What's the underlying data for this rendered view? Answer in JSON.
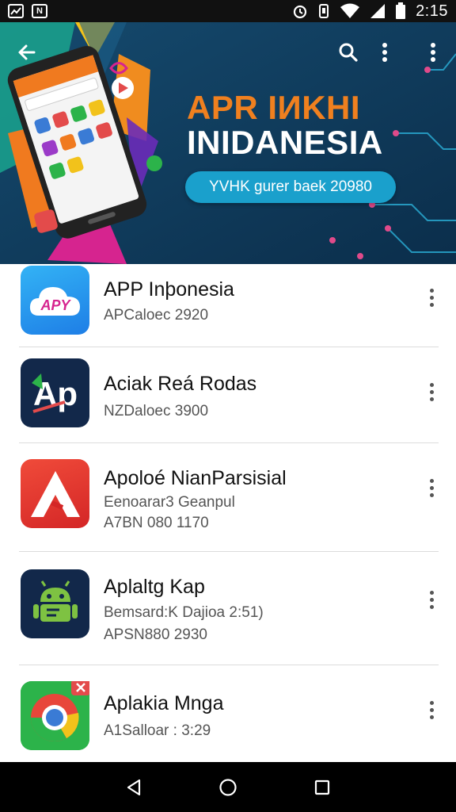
{
  "status_bar": {
    "time": "2:15",
    "icons": [
      "notification-icon",
      "news-icon",
      "alarm-icon",
      "vibrate-icon",
      "wifi-icon",
      "signal-icon",
      "battery-icon"
    ]
  },
  "banner": {
    "title_line1": "APR IИKHI",
    "title_line2": "INIDANESIA",
    "pill_text": "YVHK gurer baek 20980"
  },
  "apps": [
    {
      "name": "APP Inþonesia",
      "line1": "APCaloec 2920",
      "line2": "",
      "icon": "apy-cloud-icon",
      "icon_text": "APY"
    },
    {
      "name": "Aciak Reá Rodas",
      "line1": "NZDaloec 3900",
      "line2": "",
      "icon": "ap-logo-icon",
      "icon_text": "Ap"
    },
    {
      "name": "Apoloé NianParsisial",
      "line1": "Eenoarar3 Geanpul",
      "line2": "A7BN 080 1170",
      "icon": "red-a-icon",
      "icon_text": ""
    },
    {
      "name": "Aplaltg Kap",
      "line1": "Bemsard:K Dajioa 2:51)",
      "line2": "APSN880 2930",
      "icon": "android-icon",
      "icon_text": ""
    },
    {
      "name": "Aplakia Mnga",
      "line1": "A1Salloar : 3:29",
      "line2": "",
      "icon": "chrome-icon",
      "icon_text": ""
    }
  ],
  "colors": {
    "banner_bg": "#0e3a5e",
    "accent_orange": "#f0801f",
    "pill_blue": "#1aa0cc"
  }
}
